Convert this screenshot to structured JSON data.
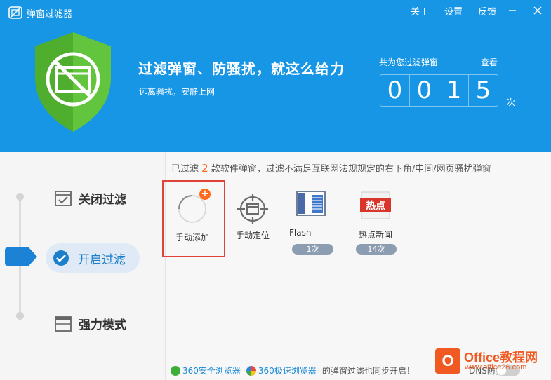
{
  "app": {
    "title": "弹窗过滤器"
  },
  "top_menu": {
    "items": [
      {
        "label": "关于"
      },
      {
        "label": "设置"
      },
      {
        "label": "反馈"
      }
    ]
  },
  "hero": {
    "headline": "过滤弹窗、防骚扰，就这么给力",
    "subline": "远离骚扰，安静上网",
    "counter_label": "共为您过滤弹窗",
    "counter_link": "查看",
    "digits": [
      "0",
      "0",
      "1",
      "5"
    ],
    "counter_unit": "次"
  },
  "modes": {
    "items": [
      {
        "label": "关闭过滤"
      },
      {
        "label": "开启过滤"
      },
      {
        "label": "强力模式"
      }
    ],
    "active_index": 1
  },
  "notice": {
    "prefix": "已过滤",
    "count": "2",
    "suffix": "款软件弹窗，过滤不满足互联网法规规定的右下角/中间/网页骚扰弹窗"
  },
  "tiles": [
    {
      "label": "手动添加",
      "badge": "+"
    },
    {
      "label": "手动定位"
    },
    {
      "label": "Flash",
      "count": "1次"
    },
    {
      "label": "热点新闻",
      "count": "14次",
      "icon_text": "热点"
    }
  ],
  "footer": {
    "browser1": "360安全浏览器",
    "browser2": "360极速浏览器",
    "text": "的弹窗过滤也同步开启！",
    "dns_label": "DNS防护"
  },
  "watermark": {
    "logo_letter": "O",
    "title": "Office教程网",
    "url": "www.office26.com"
  },
  "colors": {
    "header_bg": "#1796e6",
    "accent_blue": "#1b7fcc",
    "highlight_red": "#e0423a",
    "badge_orange": "#ff6a1a",
    "shield_green": "#5cc13a"
  }
}
